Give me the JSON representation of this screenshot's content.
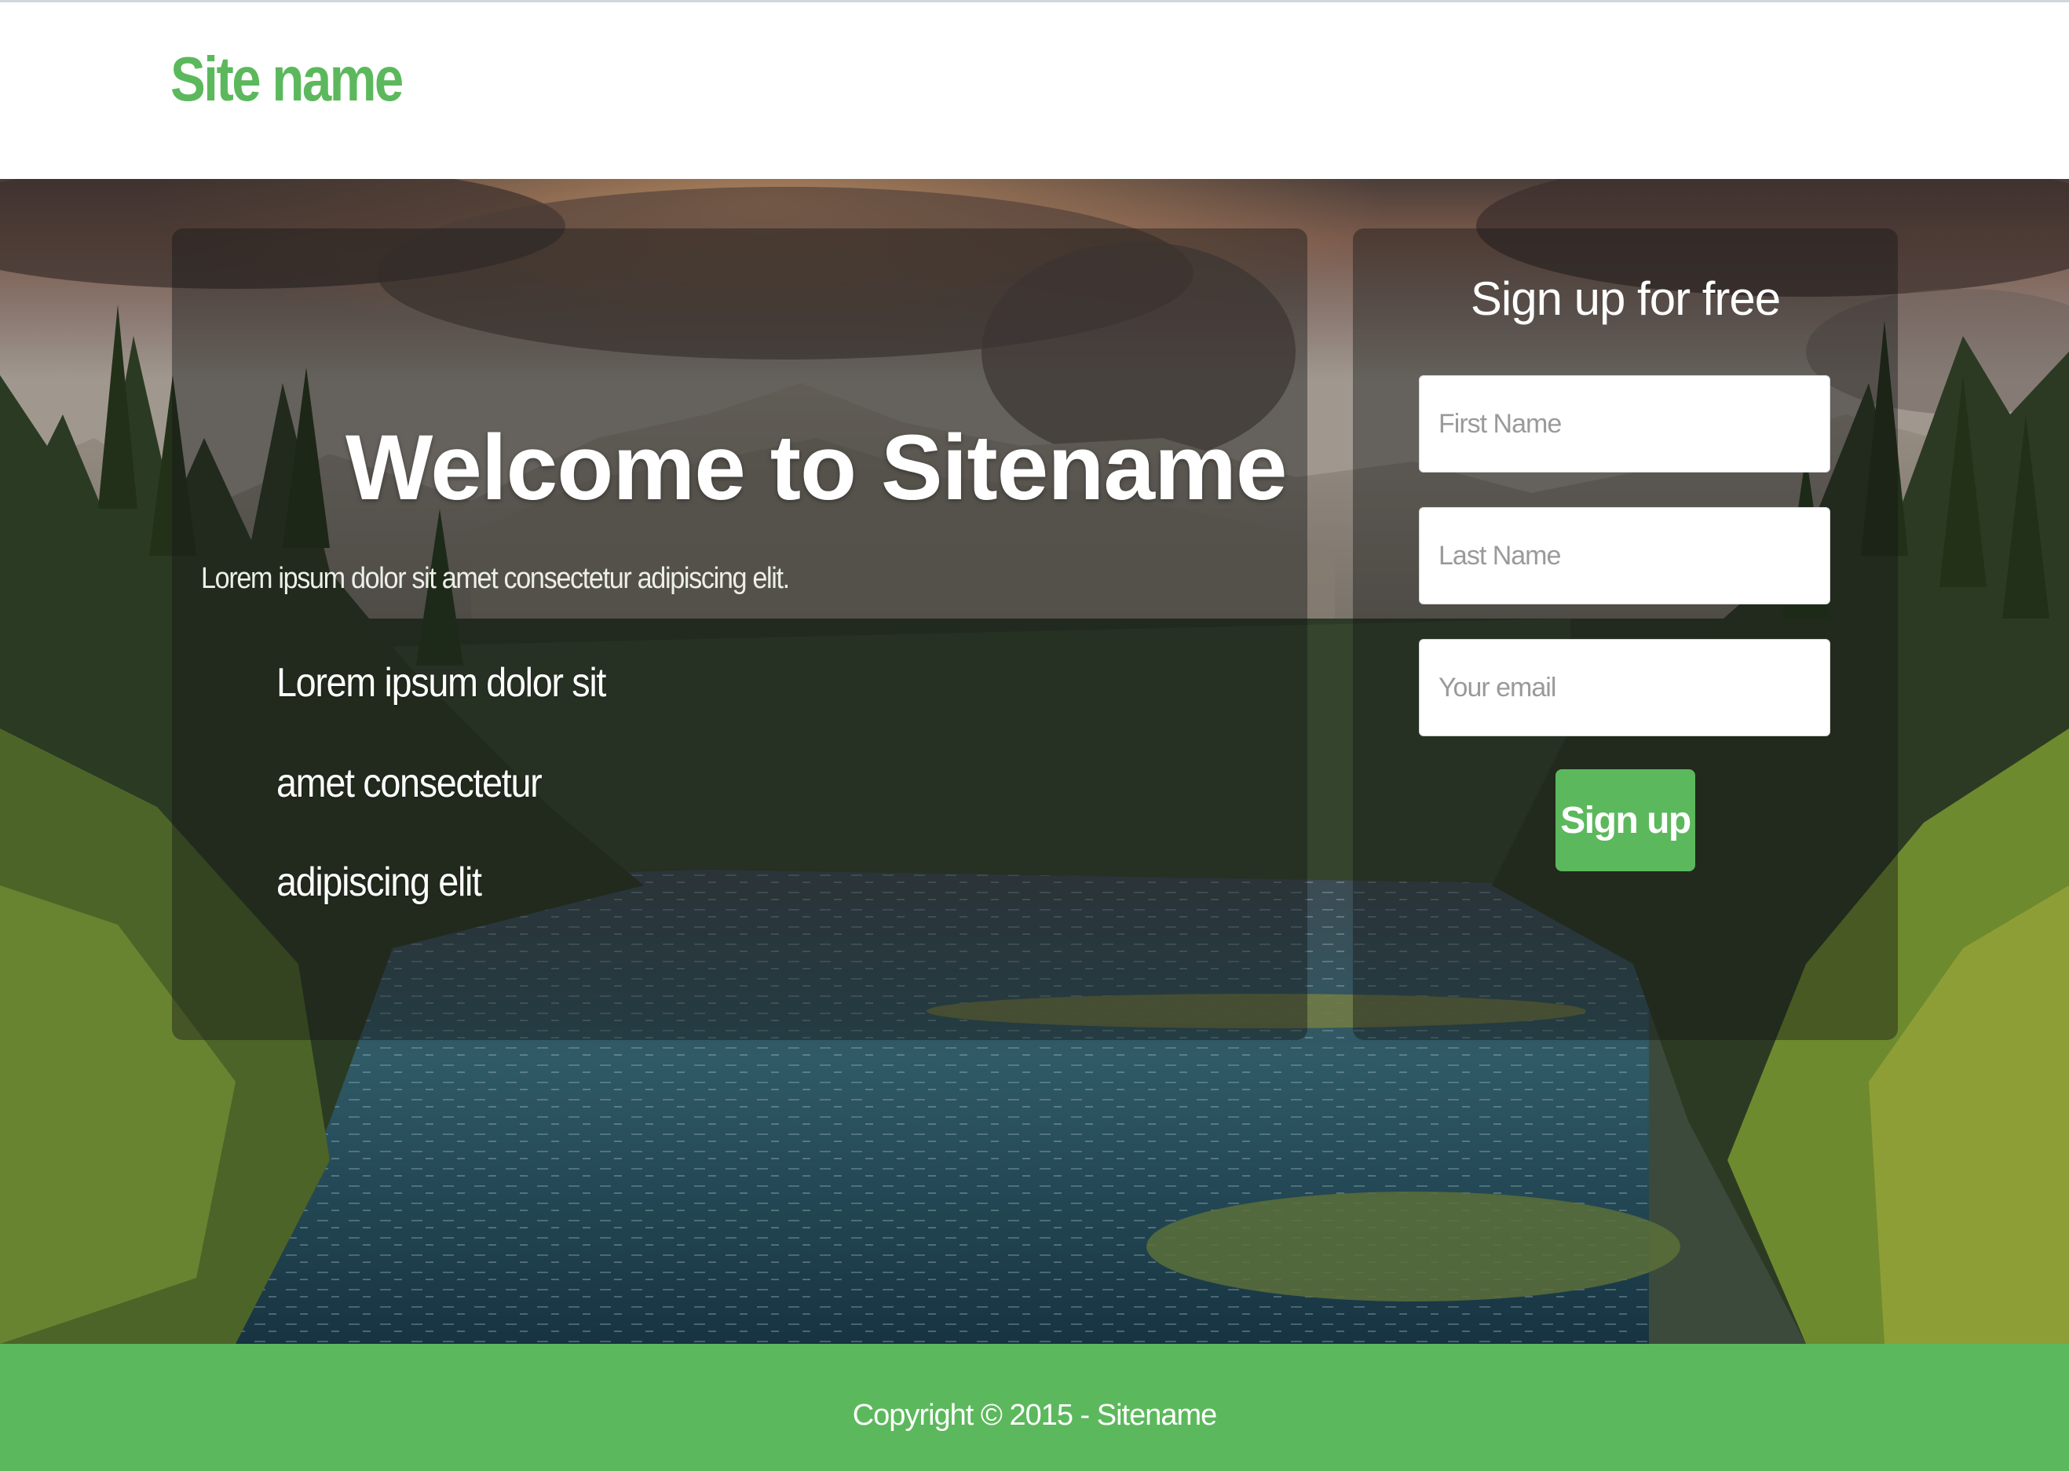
{
  "header": {
    "site_name": "Site name"
  },
  "hero": {
    "title": "Welcome to Sitename",
    "lead": "Lorem ipsum dolor sit amet consectetur adipiscing elit.",
    "bullets": [
      "Lorem ipsum dolor sit",
      "amet consectetur",
      "adipiscing elit"
    ]
  },
  "signup": {
    "title": "Sign up for free",
    "first_name_placeholder": "First Name",
    "last_name_placeholder": "Last Name",
    "email_placeholder": "Your email",
    "button_label": "Sign up"
  },
  "footer": {
    "copyright": "Copyright © 2015 - Sitename"
  },
  "colors": {
    "brand_green": "#5cb85c",
    "header_bg": "#ffffff",
    "panel_overlay": "rgba(20,22,22,0.42)"
  }
}
